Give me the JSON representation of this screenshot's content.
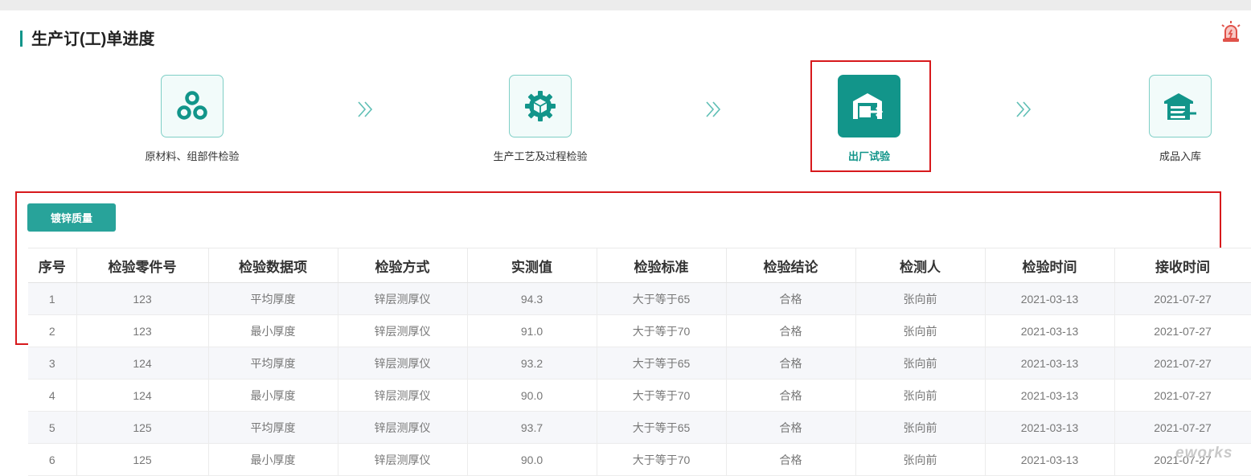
{
  "page_title": "生产订(工)单进度",
  "steps": [
    {
      "label": "原材料、组部件检验",
      "icon": "materials-circles-icon",
      "active": false
    },
    {
      "label": "生产工艺及过程检验",
      "icon": "process-gear-icon",
      "active": false
    },
    {
      "label": "出厂试验",
      "icon": "factory-outbound-icon",
      "active": true
    },
    {
      "label": "成品入库",
      "icon": "warehouse-inbound-icon",
      "active": false
    }
  ],
  "tab_button": {
    "label": "镀锌质量"
  },
  "table": {
    "headers": [
      "序号",
      "检验零件号",
      "检验数据项",
      "检验方式",
      "实测值",
      "检验标准",
      "检验结论",
      "检测人",
      "检验时间",
      "接收时间"
    ],
    "rows": [
      [
        "1",
        "123",
        "平均厚度",
        "锌层测厚仪",
        "94.3",
        "大于等于65",
        "合格",
        "张向前",
        "2021-03-13",
        "2021-07-27"
      ],
      [
        "2",
        "123",
        "最小厚度",
        "锌层测厚仪",
        "91.0",
        "大于等于70",
        "合格",
        "张向前",
        "2021-03-13",
        "2021-07-27"
      ],
      [
        "3",
        "124",
        "平均厚度",
        "锌层测厚仪",
        "93.2",
        "大于等于65",
        "合格",
        "张向前",
        "2021-03-13",
        "2021-07-27"
      ],
      [
        "4",
        "124",
        "最小厚度",
        "锌层测厚仪",
        "90.0",
        "大于等于70",
        "合格",
        "张向前",
        "2021-03-13",
        "2021-07-27"
      ],
      [
        "5",
        "125",
        "平均厚度",
        "锌层测厚仪",
        "93.7",
        "大于等于65",
        "合格",
        "张向前",
        "2021-03-13",
        "2021-07-27"
      ],
      [
        "6",
        "125",
        "最小厚度",
        "锌层测厚仪",
        "90.0",
        "大于等于70",
        "合格",
        "张向前",
        "2021-03-13",
        "2021-07-27"
      ]
    ]
  },
  "watermark": "eworks",
  "colors": {
    "accent": "#12958a",
    "button": "#28a39a",
    "highlight": "#d7191c",
    "alarm": "#e0524a"
  }
}
